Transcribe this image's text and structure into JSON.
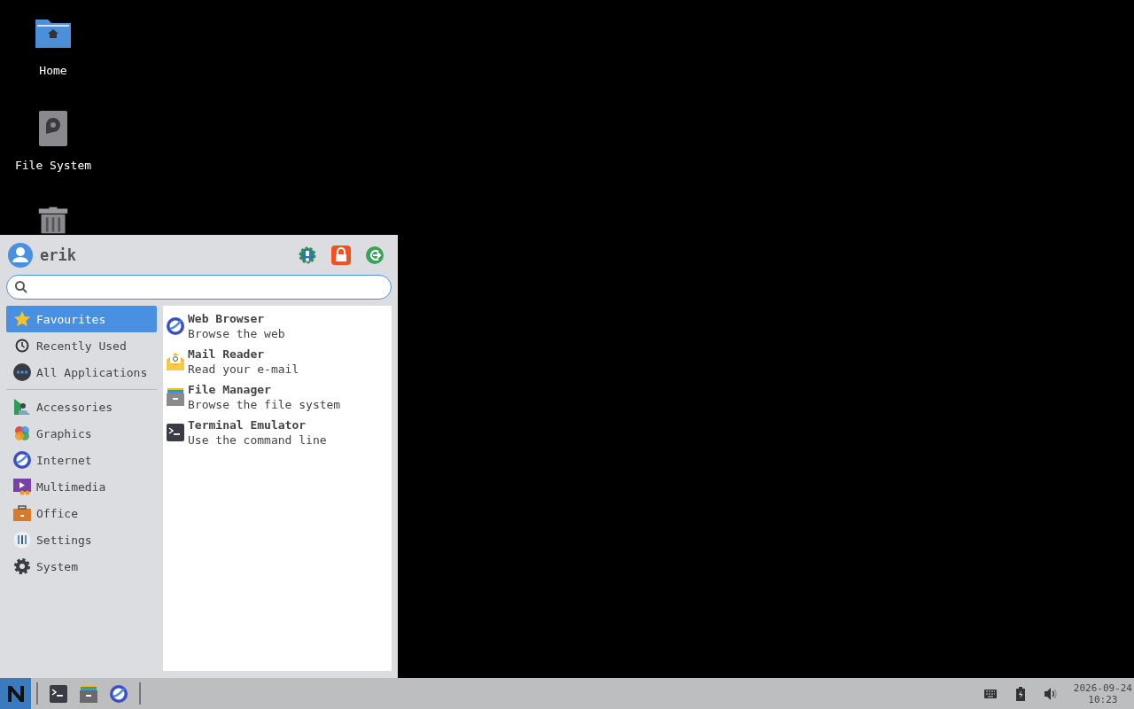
{
  "desktop_icons": [
    {
      "label": "Home"
    },
    {
      "label": "File System"
    }
  ],
  "menu": {
    "user": "erik",
    "places": [
      {
        "label": "Favourites",
        "selected": true
      },
      {
        "label": "Recently Used",
        "selected": false
      },
      {
        "label": "All Applications",
        "selected": false
      }
    ],
    "categories": [
      {
        "label": "Accessories",
        "selected": false
      },
      {
        "label": "Graphics",
        "selected": false
      },
      {
        "label": "Internet",
        "selected": false
      },
      {
        "label": "Multimedia",
        "selected": false
      },
      {
        "label": "Office",
        "selected": false
      },
      {
        "label": "Settings",
        "selected": false
      },
      {
        "label": "System",
        "selected": false
      }
    ],
    "apps": [
      {
        "name": "Web Browser",
        "description": "Browse the web"
      },
      {
        "name": "Mail Reader",
        "description": "Read your e-mail"
      },
      {
        "name": "File Manager",
        "description": "Browse the file system"
      },
      {
        "name": "Terminal Emulator",
        "description": "Use the command line"
      }
    ]
  },
  "taskbar": {
    "clock": {
      "date": "2026-09-24",
      "time": "10:23"
    }
  }
}
